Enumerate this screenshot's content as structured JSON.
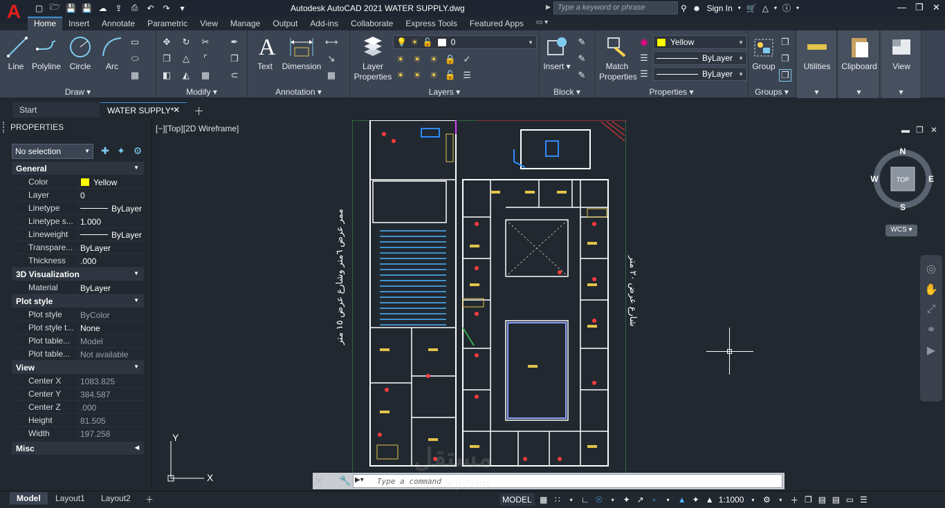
{
  "app": {
    "title": "Autodesk AutoCAD 2021    WATER SUPPLY.dwg",
    "search_placeholder": "Type a keyword or phrase",
    "sign_in": "Sign In"
  },
  "ribbon_tabs": [
    "Home",
    "Insert",
    "Annotate",
    "Parametric",
    "View",
    "Manage",
    "Output",
    "Add-ins",
    "Collaborate",
    "Express Tools",
    "Featured Apps"
  ],
  "ribbon": {
    "draw": {
      "title": "Draw",
      "line": "Line",
      "polyline": "Polyline",
      "circle": "Circle",
      "arc": "Arc"
    },
    "modify": {
      "title": "Modify"
    },
    "annotation": {
      "title": "Annotation",
      "text": "Text",
      "dimension": "Dimension"
    },
    "layers": {
      "title": "Layers",
      "layer_properties_1": "Layer",
      "layer_properties_2": "Properties",
      "current_layer": "0"
    },
    "block": {
      "title": "Block",
      "insert": "Insert"
    },
    "properties": {
      "title": "Properties",
      "match_1": "Match",
      "match_2": "Properties",
      "color": "Yellow",
      "linetype": "ByLayer",
      "lineweight": "ByLayer"
    },
    "groups": {
      "title": "Groups",
      "group": "Group"
    },
    "utilities": "Utilities",
    "clipboard": "Clipboard",
    "view": "View"
  },
  "doc_tabs": {
    "start": "Start",
    "active": "WATER SUPPLY*"
  },
  "properties_panel": {
    "title": "PROPERTIES",
    "selection": "No selection",
    "sections": {
      "general": "General",
      "visualization": "3D Visualization",
      "plot": "Plot style",
      "view": "View",
      "misc": "Misc"
    },
    "general": [
      {
        "k": "Color",
        "v": "Yellow"
      },
      {
        "k": "Layer",
        "v": "0"
      },
      {
        "k": "Linetype",
        "v": "ByLayer"
      },
      {
        "k": "Linetype s...",
        "v": "1.000"
      },
      {
        "k": "Lineweight",
        "v": "ByLayer"
      },
      {
        "k": "Transpare...",
        "v": "ByLayer"
      },
      {
        "k": "Thickness",
        "v": ".000"
      }
    ],
    "visualization": [
      {
        "k": "Material",
        "v": "ByLayer"
      }
    ],
    "plot": [
      {
        "k": "Plot style",
        "v": "ByColor"
      },
      {
        "k": "Plot style t...",
        "v": "None"
      },
      {
        "k": "Plot table...",
        "v": "Model"
      },
      {
        "k": "Plot table...",
        "v": "Not available"
      }
    ],
    "view": [
      {
        "k": "Center X",
        "v": "1083.825"
      },
      {
        "k": "Center Y",
        "v": "384.587"
      },
      {
        "k": "Center Z",
        "v": ".000"
      },
      {
        "k": "Height",
        "v": "81.505"
      },
      {
        "k": "Width",
        "v": "197.258"
      }
    ]
  },
  "viewport": {
    "label": "[−][Top][2D Wireframe]",
    "arabic_left": "ممر عرض ٦متر وشارع عرض ١٥ متر",
    "arabic_right": "شارع عرض ٢٠ متر",
    "viewcube": {
      "n": "N",
      "s": "S",
      "e": "E",
      "w": "W",
      "top": "TOP"
    },
    "wcs": "WCS",
    "ucs_x": "X",
    "ucs_y": "Y"
  },
  "command": {
    "placeholder": "Type a command"
  },
  "status": {
    "layouts": [
      "Model",
      "Layout1",
      "Layout2"
    ],
    "model": "MODEL",
    "scale": "1:1000"
  },
  "watermark": {
    "line1": "مستقل",
    "line2": "mostaql.com"
  },
  "colors": {
    "accent": "#3d8fd5",
    "layer_yellow": "#ffff00"
  }
}
